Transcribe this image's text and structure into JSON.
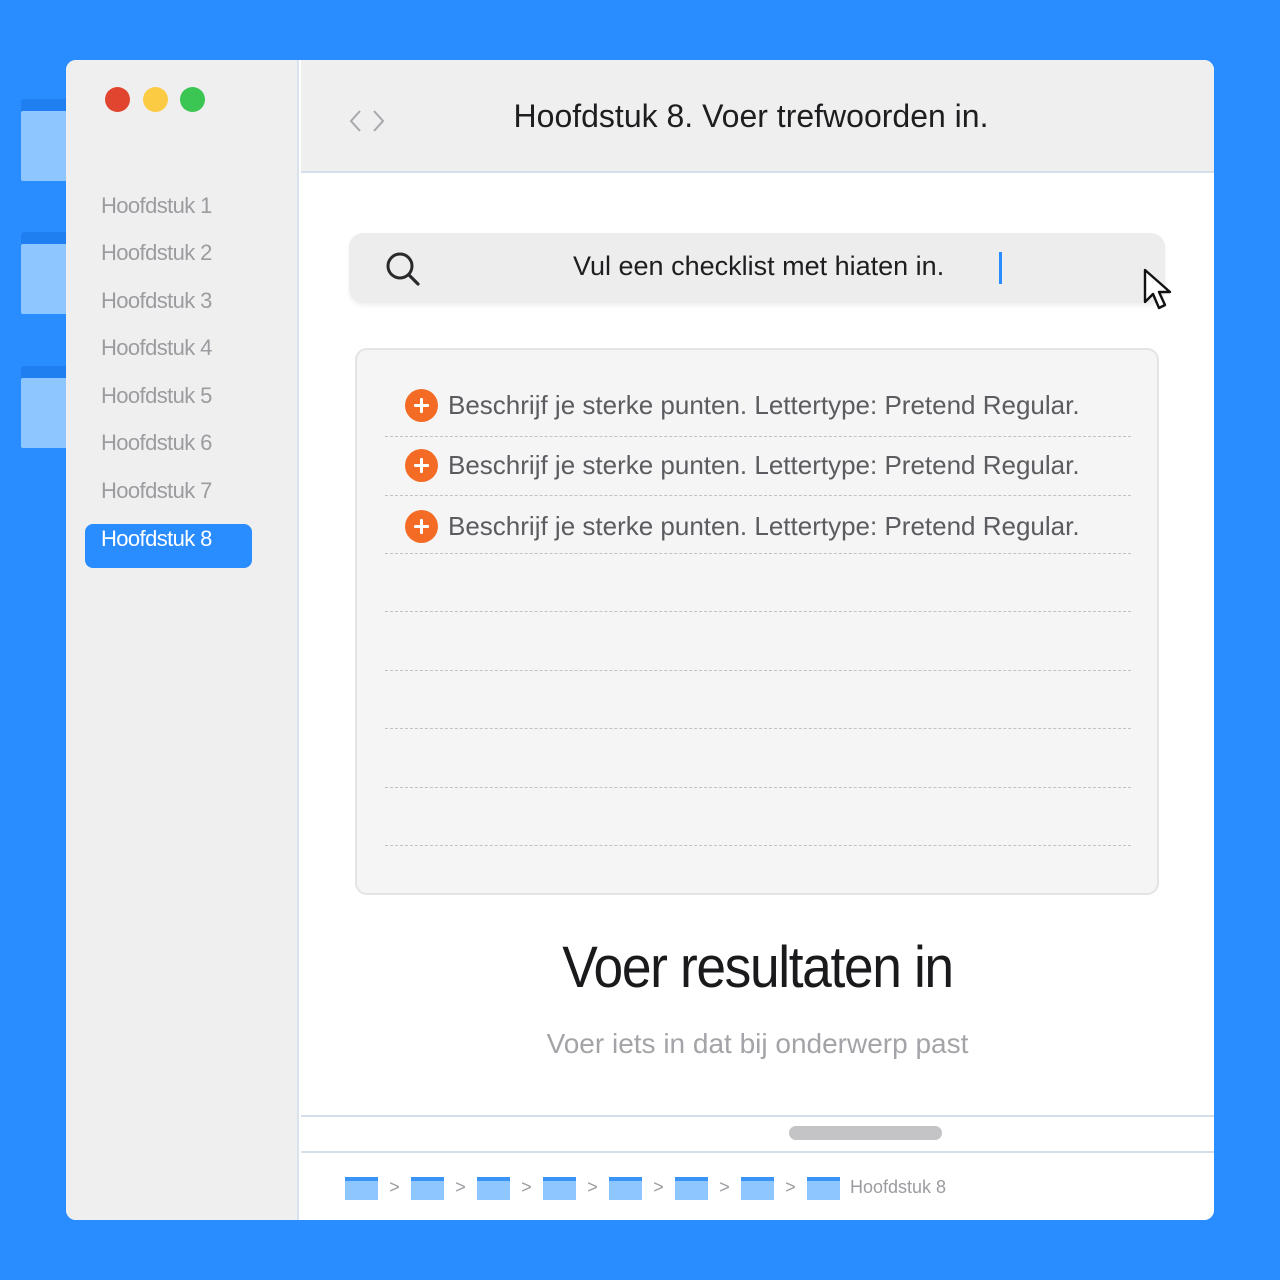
{
  "colors": {
    "background": "#2a8dff",
    "accent": "#2a8dff",
    "plus_icon": "#f46b26",
    "traffic_red": "#e2452f",
    "traffic_yellow": "#fbcb44",
    "traffic_green": "#3bc552"
  },
  "sidebar": {
    "items": [
      {
        "label": "Hoofdstuk 1"
      },
      {
        "label": "Hoofdstuk 2"
      },
      {
        "label": "Hoofdstuk 3"
      },
      {
        "label": "Hoofdstuk 4"
      },
      {
        "label": "Hoofdstuk 5"
      },
      {
        "label": "Hoofdstuk 6"
      },
      {
        "label": "Hoofdstuk 7"
      },
      {
        "label": "Hoofdstuk 8",
        "active": true
      }
    ]
  },
  "header": {
    "title": "Hoofdstuk 8. Voer trefwoorden in."
  },
  "search": {
    "value": "Vul een checklist met hiaten in."
  },
  "checklist": {
    "items": [
      {
        "text": "Beschrijf je sterke punten. Lettertype: Pretend Regular."
      },
      {
        "text": "Beschrijf je sterke punten. Lettertype: Pretend Regular."
      },
      {
        "text": "Beschrijf je sterke punten. Lettertype: Pretend Regular."
      }
    ]
  },
  "results": {
    "title": "Voer resultaten in",
    "subtitle": "Voer iets in dat bij onderwerp past"
  },
  "breadcrumb": {
    "separator": ">",
    "current": "Hoofdstuk 8"
  }
}
